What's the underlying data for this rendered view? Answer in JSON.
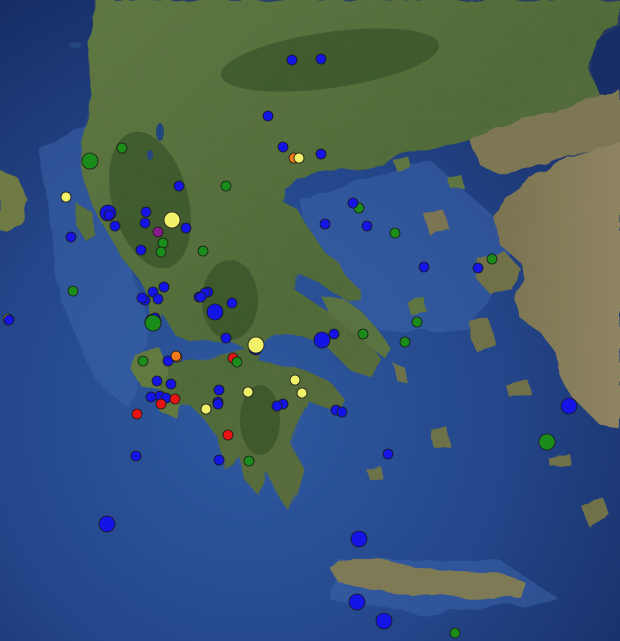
{
  "map": {
    "colors": {
      "sea_deep": "#1b3570",
      "sea": "#2a4f93",
      "shallow": "#3f6bb0",
      "land_green": "#55703c",
      "land_dark": "#3c5a2d",
      "land_brown": "#8a7b58",
      "land_light": "#a2967a"
    },
    "legend_colors": {
      "blue": "#1414e6",
      "green": "#1a8c1a",
      "yellow": "#f2f26a",
      "orange": "#f07a1a",
      "red": "#e61414",
      "purple": "#8a1a8a"
    }
  },
  "markers": [
    {
      "color": "blue",
      "mag": "M3"
    },
    {
      "color": "blue",
      "mag": "M3"
    },
    {
      "color": "blue",
      "mag": "M3"
    },
    {
      "color": "blue",
      "mag": "M3"
    },
    {
      "color": "blue",
      "mag": "M3"
    },
    {
      "color": "orange",
      "mag": "M3"
    },
    {
      "color": "yellow",
      "mag": "M3"
    },
    {
      "color": "green",
      "mag": "M4"
    },
    {
      "color": "green",
      "mag": "M3"
    },
    {
      "color": "yellow",
      "mag": "M3"
    },
    {
      "color": "blue",
      "mag": "M3"
    },
    {
      "color": "green",
      "mag": "M3"
    },
    {
      "color": "blue",
      "mag": "M4"
    },
    {
      "color": "blue",
      "mag": "M3"
    },
    {
      "color": "blue",
      "mag": "M3"
    },
    {
      "color": "yellow",
      "mag": "M4"
    },
    {
      "color": "purple",
      "mag": "M3"
    },
    {
      "color": "blue",
      "mag": "M3"
    },
    {
      "color": "blue",
      "mag": "M3"
    },
    {
      "color": "green",
      "mag": "M3"
    },
    {
      "color": "green",
      "mag": "M3"
    },
    {
      "color": "blue",
      "mag": "M3"
    },
    {
      "color": "blue",
      "mag": "M3"
    },
    {
      "color": "green",
      "mag": "M3"
    },
    {
      "color": "blue",
      "mag": "M3"
    },
    {
      "color": "blue",
      "mag": "M3"
    },
    {
      "color": "blue",
      "mag": "M3"
    },
    {
      "color": "green",
      "mag": "M3"
    },
    {
      "color": "blue",
      "mag": "M3"
    },
    {
      "color": "yellow",
      "mag": "M3"
    },
    {
      "color": "blue",
      "mag": "M3"
    },
    {
      "color": "blue",
      "mag": "M3"
    },
    {
      "color": "green",
      "mag": "M4"
    },
    {
      "color": "blue",
      "mag": "M4"
    },
    {
      "color": "blue",
      "mag": "M3"
    },
    {
      "color": "blue",
      "mag": "M3"
    },
    {
      "color": "blue",
      "mag": "M3"
    },
    {
      "color": "blue",
      "mag": "M3"
    },
    {
      "color": "blue",
      "mag": "M3"
    },
    {
      "color": "blue",
      "mag": "M3"
    },
    {
      "color": "blue",
      "mag": "M3"
    },
    {
      "color": "green",
      "mag": "M4"
    },
    {
      "color": "blue",
      "mag": "M3"
    },
    {
      "color": "blue",
      "mag": "M4"
    },
    {
      "color": "blue",
      "mag": "M3"
    },
    {
      "color": "green",
      "mag": "M3"
    },
    {
      "color": "green",
      "mag": "M3"
    },
    {
      "color": "green",
      "mag": "M3"
    },
    {
      "color": "blue",
      "mag": "M3"
    },
    {
      "color": "yellow",
      "mag": "M4"
    },
    {
      "color": "blue",
      "mag": "M3"
    },
    {
      "color": "orange",
      "mag": "M3"
    },
    {
      "color": "red",
      "mag": "M3"
    },
    {
      "color": "green",
      "mag": "M3"
    },
    {
      "color": "green",
      "mag": "M3"
    },
    {
      "color": "orange",
      "mag": "M3"
    },
    {
      "color": "blue",
      "mag": "M3"
    },
    {
      "color": "blue",
      "mag": "M3"
    },
    {
      "color": "blue",
      "mag": "M3"
    },
    {
      "color": "blue",
      "mag": "M3"
    },
    {
      "color": "blue",
      "mag": "M3"
    },
    {
      "color": "red",
      "mag": "M3"
    },
    {
      "color": "red",
      "mag": "M3"
    },
    {
      "color": "red",
      "mag": "M3"
    },
    {
      "color": "blue",
      "mag": "M3"
    },
    {
      "color": "yellow",
      "mag": "M3"
    },
    {
      "color": "blue",
      "mag": "M3"
    },
    {
      "color": "blue",
      "mag": "M3"
    },
    {
      "color": "yellow",
      "mag": "M3"
    },
    {
      "color": "yellow",
      "mag": "M3"
    },
    {
      "color": "blue",
      "mag": "M3"
    },
    {
      "color": "blue",
      "mag": "M3"
    },
    {
      "color": "blue",
      "mag": "M3"
    },
    {
      "color": "blue",
      "mag": "M3"
    },
    {
      "color": "red",
      "mag": "M3"
    },
    {
      "color": "blue",
      "mag": "M3"
    },
    {
      "color": "blue",
      "mag": "M3"
    },
    {
      "color": "green",
      "mag": "M3"
    },
    {
      "color": "blue",
      "mag": "M3"
    },
    {
      "color": "blue",
      "mag": "M4"
    },
    {
      "color": "blue",
      "mag": "M4"
    },
    {
      "color": "blue",
      "mag": "M4"
    },
    {
      "color": "blue",
      "mag": "M4"
    },
    {
      "color": "blue",
      "mag": "M4"
    },
    {
      "color": "green",
      "mag": "M4"
    },
    {
      "color": "blue",
      "mag": "M3"
    },
    {
      "color": "green",
      "mag": "M3"
    },
    {
      "color": "yellow",
      "mag": "M3"
    },
    {
      "color": "blue",
      "mag": "M3"
    },
    {
      "color": "blue",
      "mag": "M3"
    },
    {
      "color": "green",
      "mag": "M3"
    },
    {
      "color": "green",
      "mag": "M3"
    },
    {
      "color": "green",
      "mag": "M3"
    },
    {
      "color": "blue",
      "mag": "M3"
    },
    {
      "color": "blue",
      "mag": "M3"
    },
    {
      "color": "blue",
      "mag": "M3"
    },
    {
      "color": "blue",
      "mag": "M3"
    },
    {
      "color": "blue",
      "mag": "M3"
    }
  ]
}
